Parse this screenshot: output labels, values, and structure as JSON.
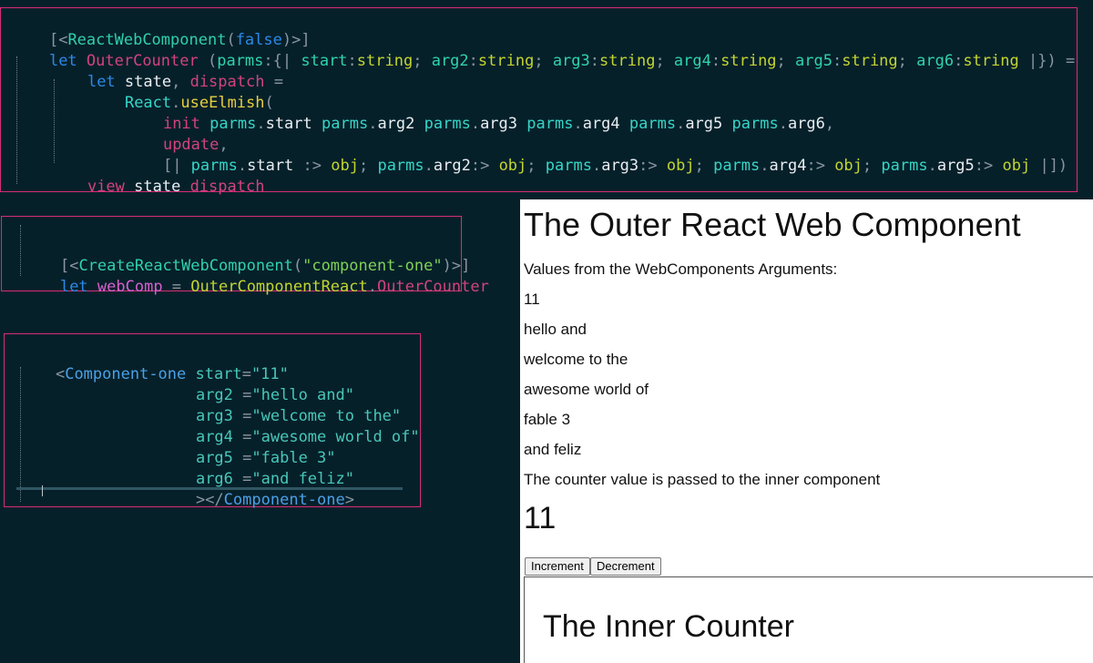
{
  "code_block_1": {
    "line1": {
      "a": "[<",
      "b": "ReactWebComponent",
      "c": "(",
      "d": "false",
      "e": ")>]"
    },
    "line2": {
      "a": "let",
      "b": " OuterCounter",
      "c": " (",
      "d": "parms",
      "e": ":{|",
      "f": " start",
      "g": ":",
      "h": "string",
      "i": ";",
      "j": " arg2",
      "k": ":",
      "l": "string",
      "m": ";",
      "n": " arg3",
      "o": ":",
      "p": "string",
      "q": ";",
      "r": " arg4",
      "s": ":",
      "t": "string",
      "u": ";",
      "v": " arg5",
      "w": ":",
      "x": "string",
      "y": ";",
      "z": " arg6",
      "aa": ":",
      "ab": "string",
      "ac": " |}) ="
    },
    "line3": {
      "a": "let",
      "b": " state",
      "c": ",",
      "d": " dispatch",
      "e": " ="
    },
    "line4": {
      "a": "React",
      "b": ".",
      "c": "useElmish",
      "d": "("
    },
    "line5": {
      "a": "init",
      "b": " parms",
      ".": ".",
      "c": "start",
      "d": " parms",
      "e": ".",
      "f": "arg2",
      "g": " parms",
      "h": ".",
      "i": "arg3",
      "j": " parms",
      "k": ".",
      "l": "arg4",
      "m": " parms",
      "n": ".",
      "o": "arg5",
      "p": " parms",
      "q": ".",
      "r": "arg6",
      "s": ","
    },
    "line6": {
      "a": "update",
      "b": ","
    },
    "line7": {
      "a": "[|",
      "b": " parms",
      ".": ".",
      "c": "start",
      "d": " :>",
      "e": " obj",
      "f": ";",
      "g": " parms",
      "h": ".",
      "i": "arg2",
      "j": ":>",
      "k": " obj",
      "l": ";",
      "m": " parms",
      "n": ".",
      "o": "arg3",
      "p": ":>",
      "q": " obj",
      "r": ";",
      "s": " parms",
      "t": ".",
      "u": "arg4",
      "v": ":>",
      "w": " obj",
      "x": ";",
      "y": " parms",
      "z": ".",
      "aa": "arg5",
      "ab": ":>",
      "ac": " obj",
      "ad": " |])"
    },
    "line8": {
      "a": "view",
      "b": " state",
      "c": " dispatch"
    }
  },
  "code_block_2": {
    "line1": {
      "a": "[<",
      "b": "CreateReactWebComponent",
      "c": "(",
      "d": "\"component-one\"",
      "e": ")>]"
    },
    "line2": {
      "a": "let",
      "b": " webComp",
      "c": " =",
      "d": " OuterComponentReact",
      "e": ".",
      "f": "OuterCounter"
    }
  },
  "code_block_3": {
    "line1": {
      "a": "<",
      "b": "Component-one",
      "c": " start",
      "d": "=",
      "e": "\"11\""
    },
    "line2": {
      "a": "arg2",
      "b": " =",
      "c": "\"hello and\""
    },
    "line3": {
      "a": "arg3",
      "b": " =",
      "c": "\"welcome to the\""
    },
    "line4": {
      "a": "arg4",
      "b": " =",
      "c": "\"awesome world of\""
    },
    "line5": {
      "a": "arg5",
      "b": " =",
      "c": "\"fable 3\""
    },
    "line6": {
      "a": "arg6",
      "b": " =",
      "c": "\"and feliz\""
    },
    "line7": {
      "a": "></",
      "b": "Component-one",
      "c": ">"
    }
  },
  "preview": {
    "title": "The Outer React Web Component",
    "subtitle": "Values from the WebComponents Arguments:",
    "values": [
      "11",
      "hello and",
      "welcome to the",
      "awesome world of",
      "fable 3",
      "and feliz"
    ],
    "note": "The counter value is passed to the inner component",
    "counter": "11",
    "increment_label": "Increment",
    "decrement_label": "Decrement",
    "inner_title": "The Inner Counter"
  }
}
